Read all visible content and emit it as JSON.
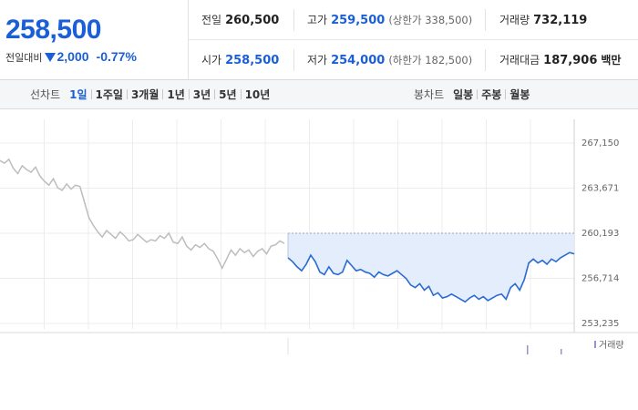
{
  "quote": {
    "price": "258,500",
    "change_label": "전일대비",
    "change_icon": "down-triangle-icon",
    "change_value": "2,000",
    "change_percent": "-0.77%",
    "color_down": "#1b5fd6",
    "fields": {
      "prev_close": {
        "label": "전일",
        "value": "260,500"
      },
      "high": {
        "label": "고가",
        "value": "259,500",
        "sub": "(상한가 338,500)"
      },
      "volume": {
        "label": "거래량",
        "value": "732,119"
      },
      "open": {
        "label": "시가",
        "value": "258,500"
      },
      "low": {
        "label": "저가",
        "value": "254,000",
        "sub": "(하한가 182,500)"
      },
      "amount": {
        "label": "거래대금",
        "value": "187,906",
        "unit": "백만"
      }
    }
  },
  "tabs": {
    "line_chart_title": "선차트",
    "line_periods": [
      "1일",
      "1주일",
      "3개월",
      "1년",
      "3년",
      "5년",
      "10년"
    ],
    "active_period": "1일",
    "candle_chart_title": "봉차트",
    "candle_periods": [
      "일봉",
      "주봉",
      "월봉"
    ]
  },
  "chart_data": {
    "type": "line",
    "y_ticks": [
      "267,150",
      "263,671",
      "260,193",
      "256,714",
      "253,235"
    ],
    "ylim": [
      253235,
      267150
    ],
    "reference_price": 260193,
    "previous_day_series": [
      265800,
      265600,
      265900,
      265200,
      264800,
      265400,
      265100,
      264900,
      265300,
      264600,
      264200,
      263900,
      264400,
      263700,
      263500,
      264000,
      263600,
      263900,
      263800,
      262600,
      261400,
      260800,
      260300,
      259900,
      260400,
      260100,
      259800,
      260300,
      260000,
      259600,
      259700,
      260100,
      259800,
      259500,
      259700,
      259600,
      260000,
      259800,
      260200,
      259500,
      259400,
      259900,
      259200,
      258900,
      259300,
      259100,
      259400,
      259000,
      258800,
      258200,
      257500,
      258200,
      258900,
      258500,
      259000,
      258700,
      258900,
      258400,
      258800,
      259000,
      258600,
      259200,
      259300,
      259600,
      259400
    ],
    "today_series": [
      258300,
      258000,
      257600,
      257300,
      257800,
      258500,
      258000,
      257200,
      257000,
      257600,
      257100,
      257000,
      257200,
      258100,
      257700,
      257300,
      257400,
      257200,
      257100,
      256800,
      257200,
      257000,
      256900,
      257100,
      257300,
      257000,
      256700,
      256200,
      256000,
      256300,
      255800,
      256100,
      255400,
      255600,
      255200,
      255300,
      255500,
      255300,
      255100,
      254900,
      255200,
      255400,
      255100,
      255300,
      255000,
      255200,
      255400,
      255500,
      255100,
      256000,
      256300,
      255800,
      256600,
      257900,
      258200,
      257900,
      258100,
      257800,
      258200,
      258000,
      258300,
      258500,
      258700,
      258600
    ],
    "colors": {
      "today_line": "#2a6bd4",
      "today_fill": "#e4edfb",
      "prev_line": "#bdbdbd",
      "grid": "#ececec"
    },
    "volume_legend": "거래량"
  }
}
